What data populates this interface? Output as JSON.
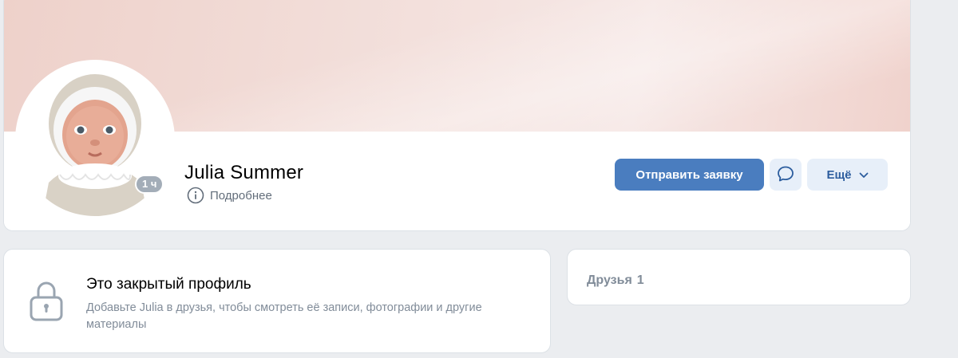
{
  "profile": {
    "name": "Julia Summer",
    "details_label": "Подробнее",
    "online_badge": "1 ч",
    "avatar_alt": "avatar"
  },
  "actions": {
    "send_request_label": "Отправить заявку",
    "more_label": "Ещё"
  },
  "closed_profile": {
    "title": "Это закрытый профиль",
    "description": "Добавьте Julia в друзья, чтобы смотреть её записи, фотографии и другие материалы"
  },
  "friends": {
    "label": "Друзья",
    "count": "1"
  },
  "colors": {
    "accent": "#4a7dbf",
    "secondary_button_bg": "#e7eff9",
    "secondary_button_text": "#2c5d9e",
    "page_bg": "#ebedf0",
    "muted_text": "#818c99"
  },
  "icons": {
    "message": "message-bubble-icon",
    "more_chevron": "chevron-down-icon",
    "details": "info-circle-icon",
    "closed": "lock-icon"
  }
}
